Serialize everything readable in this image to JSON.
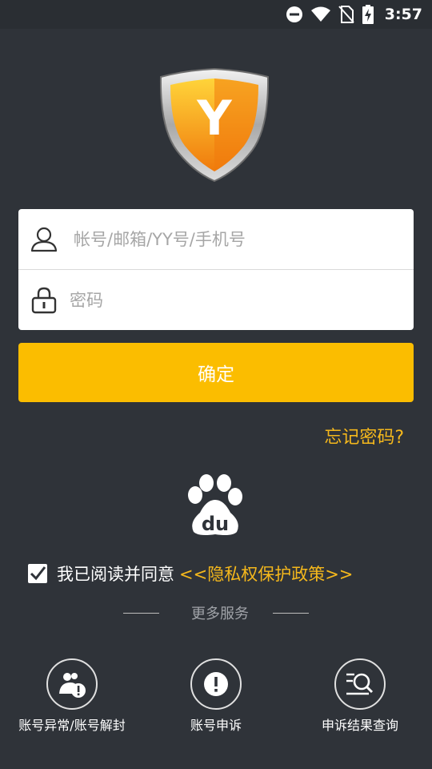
{
  "status_bar": {
    "time": "3:57",
    "icons": [
      "do-not-disturb-icon",
      "wifi-icon",
      "no-sim-icon",
      "battery-charging-icon"
    ]
  },
  "logo": {
    "letter": "Y",
    "icon": "yy-shield-logo"
  },
  "login": {
    "account_placeholder": "帐号/邮箱/YY号/手机号",
    "account_value": "",
    "password_placeholder": "密码",
    "password_value": "",
    "account_icon": "user-icon",
    "password_icon": "lock-icon"
  },
  "confirm_label": "确定",
  "forgot_password_label": "忘记密码?",
  "baidu": {
    "logo_text": "du",
    "icon": "baidu-paw-logo"
  },
  "agreement": {
    "checked": true,
    "text": "我已阅读并同意",
    "policy_link": "<<隐私权保护政策>>"
  },
  "more_services_label": "更多服务",
  "services": [
    {
      "label": "账号异常/账号解封",
      "icon": "account-warning-icon"
    },
    {
      "label": "账号申诉",
      "icon": "exclamation-icon"
    },
    {
      "label": "申诉结果查询",
      "icon": "search-list-icon"
    }
  ],
  "colors": {
    "background": "#2f3339",
    "accent": "#fbbd00",
    "link": "#f5b81c"
  }
}
